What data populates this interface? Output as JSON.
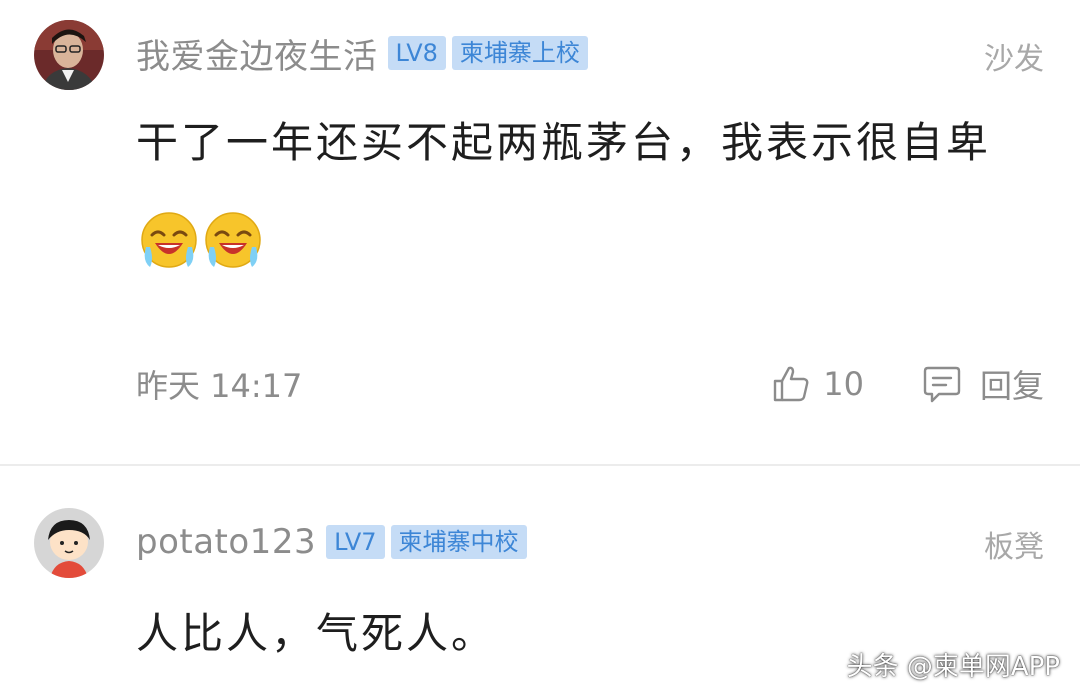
{
  "comments": [
    {
      "username": "我爱金边夜生活",
      "level": "LV8",
      "rank": "柬埔寨上校",
      "floor": "沙发",
      "text": "干了一年还买不起两瓶茅台，我表示很自卑",
      "emojis": [
        "crying-laugh-emoji",
        "crying-laugh-emoji"
      ],
      "time": "昨天 14:17",
      "likes": "10",
      "reply_label": "回复"
    },
    {
      "username": "potato123",
      "level": "LV7",
      "rank": "柬埔寨中校",
      "floor": "板凳",
      "text": "人比人，气死人。"
    }
  ],
  "icons": {
    "like": "thumbs-up-icon",
    "reply": "speech-bubble-icon"
  },
  "colors": {
    "badge_bg": "#c5dcf6",
    "badge_text": "#3d86d6",
    "meta_text": "#8c8c8c"
  },
  "watermark": "头条 @柬单网APP"
}
